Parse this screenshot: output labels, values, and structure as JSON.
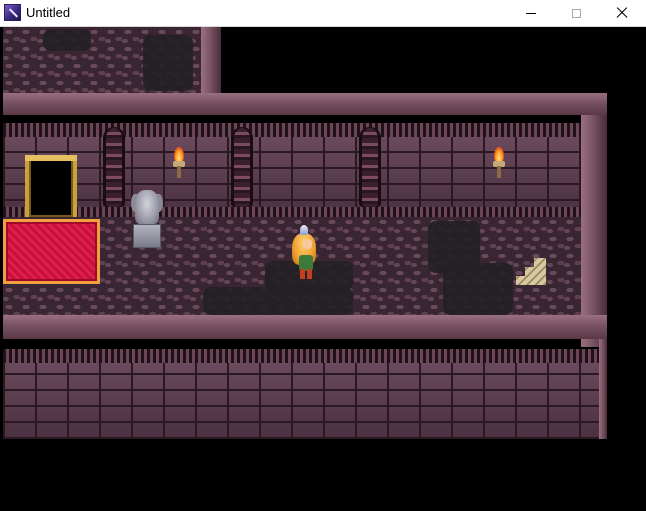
{
  "window": {
    "title": "Untitled",
    "controls": {
      "minimize": "minimize",
      "maximize": "maximize",
      "close": "close"
    }
  },
  "scene": {
    "icons": [
      "app-icon",
      "torch-icon",
      "gargoyle-statue",
      "player-character",
      "staircase-icon",
      "doorway",
      "red-carpet"
    ],
    "colors": {
      "floor": "#3a2632",
      "wall": "#4e3444",
      "rim": "#7a5464",
      "carpet": "#c8103c",
      "carpet_border": "#f0a040",
      "door_frame": "#c8a040",
      "flame": "#ff9a2a"
    }
  }
}
